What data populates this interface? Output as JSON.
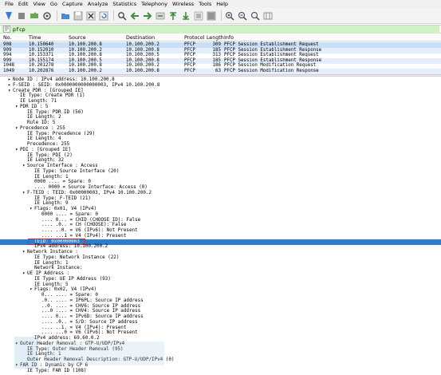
{
  "menu": [
    "File",
    "Edit",
    "View",
    "Go",
    "Capture",
    "Analyze",
    "Statistics",
    "Telephony",
    "Wireless",
    "Tools",
    "Help"
  ],
  "filter": {
    "value": "pfcp"
  },
  "packet_list": {
    "headers": [
      "No.",
      "Time",
      "Source",
      "Destination",
      "Protocol",
      "Length",
      "Info"
    ],
    "rows": [
      [
        "908",
        "10.150640",
        "10.100.200.8",
        "10.100.200.2",
        "PFCP",
        "309",
        "PFCP Session Establishment Request"
      ],
      [
        "909",
        "10.152010",
        "10.100.200.2",
        "10.100.200.8",
        "PFCP",
        "185",
        "PFCP Session Establishment Response"
      ],
      [
        "994",
        "10.153371",
        "10.100.200.8",
        "10.100.200.5",
        "PFCP",
        "313",
        "PFCP Session Establishment Request"
      ],
      [
        "999",
        "10.155174",
        "10.100.200.5",
        "10.100.200.8",
        "PFCP",
        "185",
        "PFCP Session Establishment Response"
      ],
      [
        "1048",
        "10.201278",
        "10.100.200.8",
        "10.100.200.2",
        "PFCP",
        "186",
        "PFCP Session Modification Request"
      ],
      [
        "1049",
        "10.202876",
        "10.100.200.2",
        "10.100.200.8",
        "PFCP",
        "63",
        "PFCP Session Modification Response"
      ]
    ]
  },
  "details": [
    {
      "t": "Node ID : IPv4 address: 10.100.200.8",
      "a": "▸"
    },
    {
      "t": "F-SEID : SEID: 0x0000000000000003, IPv4 10.100.200.8",
      "a": "▸"
    },
    {
      "t": "Create PDR : [Grouped IE]",
      "a": "▾"
    },
    {
      "t": "IE Type: Create PDR (1)",
      "a": ""
    },
    {
      "t": "IE Length: 71",
      "a": ""
    },
    {
      "t": "PDR ID : 5",
      "a": "▾"
    },
    {
      "t": "IE Type: PDR ID (56)",
      "a": ""
    },
    {
      "t": "IE Length: 2",
      "a": ""
    },
    {
      "t": "Rule ID: 5",
      "a": ""
    },
    {
      "t": "Precedence : 255",
      "a": "▾"
    },
    {
      "t": "IE Type: Precedence (29)",
      "a": ""
    },
    {
      "t": "IE Length: 4",
      "a": ""
    },
    {
      "t": "Precedence: 255",
      "a": ""
    },
    {
      "t": "PDI : [Grouped IE]",
      "a": "▾"
    },
    {
      "t": "IE Type: PDI (2)",
      "a": ""
    },
    {
      "t": "IE Length: 32",
      "a": ""
    },
    {
      "t": "Source Interface : Access",
      "a": "▾"
    },
    {
      "t": "IE Type: Source Interface (20)",
      "a": ""
    },
    {
      "t": "IE Length: 1",
      "a": ""
    },
    {
      "t": "0000 .... = Spare: 0",
      "a": ""
    },
    {
      "t": ".... 0000 = Source Interface: Access (0)",
      "a": ""
    },
    {
      "t": "F-TEID : TEID: 0x00000003, IPv4 10.100.200.2",
      "a": "▾"
    },
    {
      "t": "IE Type: F-TEID (21)",
      "a": ""
    },
    {
      "t": "IE Length: 9",
      "a": ""
    },
    {
      "t": "Flags: 0x01, V4 (IPv4)",
      "a": "▾"
    },
    {
      "t": "0000 .... = Spare: 0",
      "a": ""
    },
    {
      "t": ".... 0... = CHID (CHOOSE_ID): False",
      "a": ""
    },
    {
      "t": ".... .0.. = CH (CHOOSE): False",
      "a": ""
    },
    {
      "t": ".... ..0. = V6 (IPv6): Not Present",
      "a": ""
    },
    {
      "t": ".... ...1 = V4 (IPv4): Present",
      "a": ""
    },
    {
      "t": "TEID: 0x00000003",
      "a": ""
    },
    {
      "t": "IPv4 address: 10.100.200.2",
      "a": ""
    },
    {
      "t": "Network Instance :",
      "a": "▾"
    },
    {
      "t": "IE Type: Network Instance (22)",
      "a": ""
    },
    {
      "t": "IE Length: 1",
      "a": ""
    },
    {
      "t": "Network Instance:",
      "a": ""
    },
    {
      "t": "UE IP Address :",
      "a": "▾"
    },
    {
      "t": "IE Type: UE IP Address (93)",
      "a": ""
    },
    {
      "t": "IE Length: 5",
      "a": ""
    },
    {
      "t": "Flags: 0x02, V4 (IPv4)",
      "a": "▾"
    },
    {
      "t": "0... .... = Spare: 0",
      "a": ""
    },
    {
      "t": ".0.. .... = IP6PL: Source IP address",
      "a": ""
    },
    {
      "t": "..0. .... = CHV6: Source IP address",
      "a": ""
    },
    {
      "t": "...0 .... = CHV4: Source IP address",
      "a": ""
    },
    {
      "t": ".... 0... = IPv6D: Source IP address",
      "a": ""
    },
    {
      "t": ".... .0.. = S/D: Source IP address",
      "a": ""
    },
    {
      "t": ".... ..1. = V4 (IPv4): Present",
      "a": ""
    },
    {
      "t": ".... ...0 = V6 (IPv6): Not Present",
      "a": ""
    },
    {
      "t": "IPv4 address: 69.60.0.2",
      "a": ""
    },
    {
      "t": "Outer Header Removal : GTP-U/UDP/IPv4",
      "a": "▾"
    },
    {
      "t": "IE Type: Outer Header Removal (95)",
      "a": ""
    },
    {
      "t": "IE Length: 1",
      "a": ""
    },
    {
      "t": "Outer Header Removal Description: GTP-U/UDP/IPv4 (0)",
      "a": ""
    },
    {
      "t": "FAR ID : Dynamic by CP 6",
      "a": "▾"
    },
    {
      "t": "IE Type: FAR ID (108)",
      "a": ""
    }
  ],
  "colors": {
    "selected_row": "#c7dff7",
    "highlight": "#2e7bd0",
    "filter_ok": "#cff3c4",
    "red_box": "#d23030"
  }
}
